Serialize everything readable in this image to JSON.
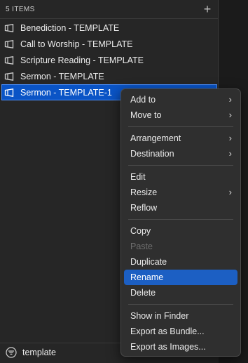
{
  "header": {
    "title": "5 ITEMS",
    "add_icon": "plus-icon",
    "add_glyph": "+"
  },
  "items": [
    {
      "label": "Benediction - TEMPLATE",
      "icon": "document-icon"
    },
    {
      "label": "Call to Worship - TEMPLATE",
      "icon": "document-icon"
    },
    {
      "label": "Scripture Reading - TEMPLATE",
      "icon": "document-icon"
    },
    {
      "label": "Sermon - TEMPLATE",
      "icon": "document-icon"
    },
    {
      "label": "Sermon - TEMPLATE-1",
      "icon": "document-icon",
      "selected": true
    }
  ],
  "footer": {
    "filter_icon": "filter-icon",
    "filter_value": "template"
  },
  "context_menu": {
    "groups": [
      [
        {
          "label": "Add to",
          "submenu": true
        },
        {
          "label": "Move to",
          "submenu": true
        }
      ],
      [
        {
          "label": "Arrangement",
          "submenu": true
        },
        {
          "label": "Destination",
          "submenu": true
        }
      ],
      [
        {
          "label": "Edit"
        },
        {
          "label": "Resize",
          "submenu": true
        },
        {
          "label": "Reflow"
        }
      ],
      [
        {
          "label": "Copy"
        },
        {
          "label": "Paste",
          "disabled": true
        },
        {
          "label": "Duplicate"
        },
        {
          "label": "Rename",
          "highlighted": true
        },
        {
          "label": "Delete"
        }
      ],
      [
        {
          "label": "Show in Finder"
        },
        {
          "label": "Export as Bundle..."
        },
        {
          "label": "Export as Images..."
        }
      ]
    ]
  },
  "colors": {
    "selection": "#0a54c6",
    "menu_highlight": "#1c5fc3",
    "panel_bg": "#262626"
  }
}
